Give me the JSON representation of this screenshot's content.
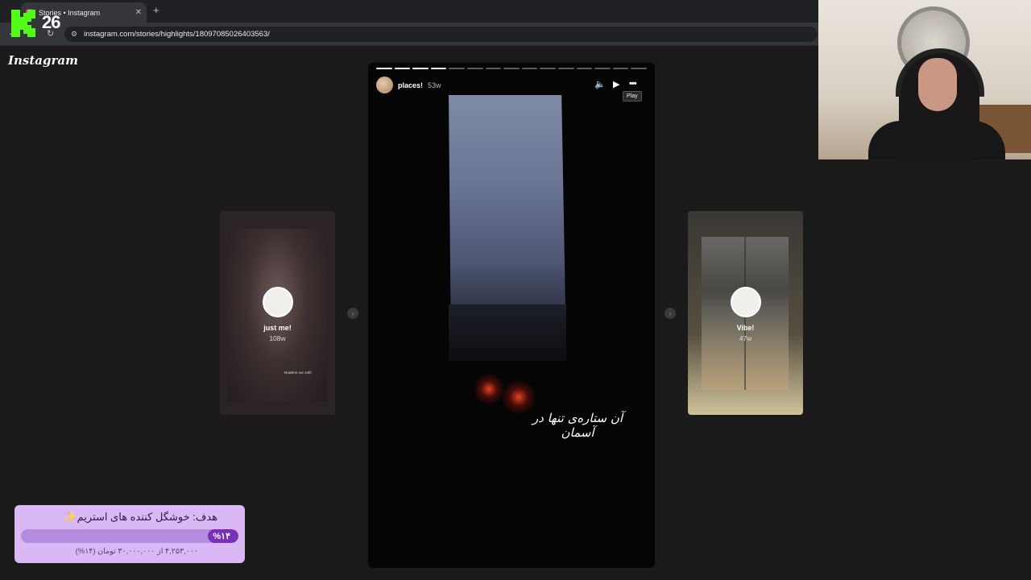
{
  "browser": {
    "tab_title": "Stories • Instagram",
    "close_glyph": "✕",
    "new_tab_glyph": "+",
    "url": "instagram.com/stories/highlights/18097085026403563/",
    "back_glyph": "←",
    "reload_glyph": "↻",
    "site_settings_glyph": "⚙"
  },
  "overlay": {
    "kick_logo_icon": "kick-logo",
    "viewer_count": "26",
    "kick_color": "#53fc18"
  },
  "instagram": {
    "logo": "Instagram",
    "story": {
      "username": "places!",
      "time": "53w",
      "progress_total": 15,
      "progress_done": 4,
      "mute_glyph": "🔈",
      "play_glyph": "▶",
      "more_glyph": "•••",
      "tooltip": "Play",
      "caption": "آن ستاره‌ی تنها در آسمان"
    },
    "prev_highlight": {
      "name": "just me!",
      "time": "108w",
      "note": "Nowlme our soft!"
    },
    "next_highlight": {
      "name": "Vibe!",
      "time": "47w"
    },
    "prev_arrow_glyph": "‹",
    "next_arrow_glyph": "›"
  },
  "goal_widget": {
    "title": "هدف: خوشگل کننده های استریم✨",
    "percent_label": "%۱۴",
    "progress": 0.14,
    "subtitle": "۴,۲۵۳,۰۰۰ از ۳۰,۰۰۰,۰۰۰ تومان (۱۴%)",
    "bar_color": "#7a2fb8",
    "background_color": "#d9b8f5"
  }
}
